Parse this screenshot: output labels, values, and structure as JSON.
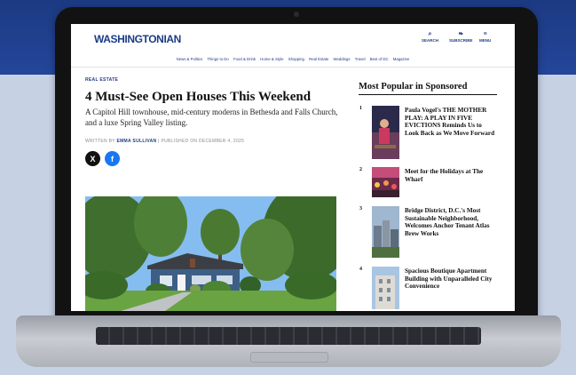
{
  "site": {
    "logo": "WASHINGTONIAN",
    "header_actions": [
      {
        "icon": "search-icon",
        "glyph": "⌕",
        "label": "SEARCH"
      },
      {
        "icon": "twitter-bird-icon",
        "glyph": "❧",
        "label": "SUBSCRIBE"
      },
      {
        "icon": "hamburger-menu-icon",
        "glyph": "≡",
        "label": "MENU"
      }
    ],
    "nav": [
      "News & Politics",
      "Things to Do",
      "Food & Drink",
      "Home & Style",
      "Shopping",
      "Real Estate",
      "Weddings",
      "Travel",
      "Best of DC",
      "Magazine"
    ]
  },
  "article": {
    "kicker": "REAL ESTATE",
    "headline": "4 Must-See Open Houses This Weekend",
    "dek": "A Capitol Hill townhouse, mid-century moderns in Bethesda and Falls Church, and a luxe Spring Valley listing.",
    "byline_prefix": "WRITTEN BY",
    "author": "EMMA SULLIVAN",
    "published": "| PUBLISHED ON DECEMBER 4, 2025",
    "share": [
      {
        "icon": "x-logo-icon",
        "glyph": "X"
      },
      {
        "icon": "facebook-icon",
        "glyph": "f"
      }
    ]
  },
  "sidebar": {
    "title": "Most Popular in Sponsored",
    "items": [
      {
        "num": "1",
        "text": "Paula Vogel's THE MOTHER PLAY: A PLAY IN FIVE EVICTIONS Reminds Us to Look Back as We Move Forward"
      },
      {
        "num": "2",
        "text": "Meet for the Holidays at The Wharf"
      },
      {
        "num": "3",
        "text": "Bridge District, D.C.'s Most Sustainable Neighborhood, Welcomes Anchor Tenant Atlas Brew Works"
      },
      {
        "num": "4",
        "text": "Spacious Boutique Apartment Building with Unparalleled City Convenience"
      }
    ]
  },
  "colors": {
    "brand_blue": "#1d3c86",
    "background_band": "#1c3a82",
    "background_lower": "#c6d2e4",
    "facebook_blue": "#1877f2"
  }
}
